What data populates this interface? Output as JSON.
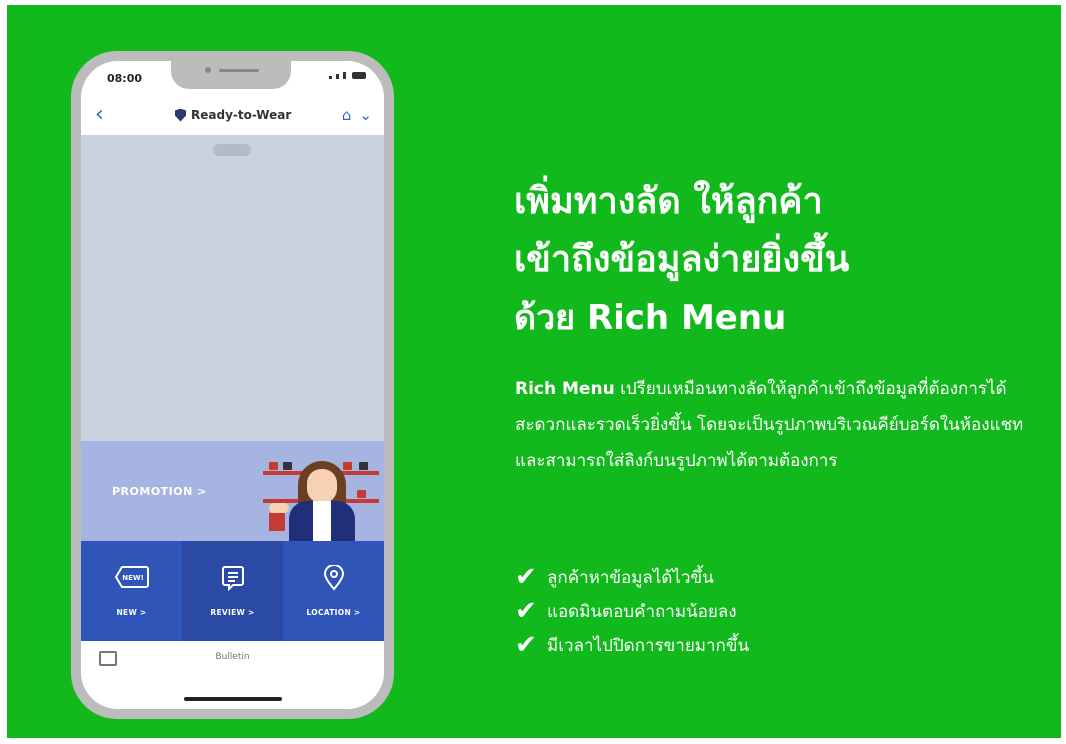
{
  "phone": {
    "status_time": "08:00",
    "chat_title": "Ready-to-Wear",
    "icons": [
      "back-arrow-icon",
      "shield-icon",
      "home-icon",
      "chevron-down-icon"
    ],
    "promotion_label": "PROMOTION >",
    "rich_menu": [
      {
        "label": "NEW >",
        "icon": "new-tag-icon",
        "icon_text": "NEW!"
      },
      {
        "label": "REVIEW >",
        "icon": "review-document-icon"
      },
      {
        "label": "LOCATION >",
        "icon": "location-pin-icon"
      }
    ],
    "footer_label": "Bulletin"
  },
  "headline": {
    "line1": "เพิ่มทางลัด ให้ลูกค้า",
    "line2": "เข้าถึงข้อมูลง่ายยิ่งขึ้น",
    "line3_prefix": "ด้วย",
    "line3_brand": "Rich Menu"
  },
  "description": {
    "brand": "Rich Menu",
    "text": " เปรียบเหมือนทางลัดให้ลูกค้าเข้าถึงข้อมูลที่ต้องการได้สะดวกและรวดเร็วยิ่งขึ้น โดยจะเป็นรูปภาพบริเวณคีย์บอร์ดในห้องแชท และสามารถใส่ลิงก์บนรูปภาพได้ตามต้องการ"
  },
  "benefits": [
    "ลูกค้าหาข้อมูลได้ไวขึ้น",
    "แอดมินตอบคำถามน้อยลง",
    "มีเวลาไปปิดการขายมากขึ้น"
  ],
  "colors": {
    "background": "#11b91c",
    "rich_menu_blue": "#2f55b9",
    "promotion_blue": "#a6b4e1",
    "phone_frame": "#bcbcbc"
  }
}
